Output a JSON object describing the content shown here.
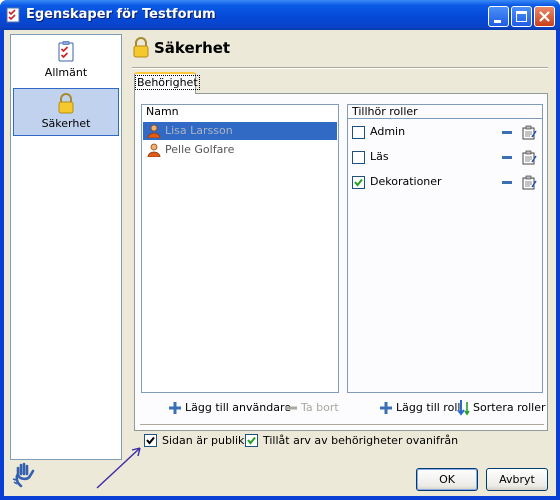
{
  "window": {
    "title": "Egenskaper för Testforum",
    "controls": [
      "minimize-icon",
      "maximize-icon",
      "close-icon"
    ]
  },
  "nav": {
    "items": [
      {
        "label": "Allmänt",
        "icon": "checklist-icon",
        "selected": false
      },
      {
        "label": "Säkerhet",
        "icon": "padlock-icon",
        "selected": true
      }
    ]
  },
  "header": {
    "title": "Säkerhet",
    "icon": "padlock-icon"
  },
  "tabs": [
    {
      "label": "Behörighet",
      "active": true
    }
  ],
  "users": {
    "column": "Namn",
    "rows": [
      {
        "name": "Lisa Larsson",
        "selected": true
      },
      {
        "name": "Pelle Golfare",
        "selected": false
      }
    ],
    "add_label": "Lägg till användare",
    "remove_label": "Ta bort"
  },
  "roles": {
    "column": "Tillhör roller",
    "rows": [
      {
        "name": "Admin",
        "checked": false
      },
      {
        "name": "Läs",
        "checked": false
      },
      {
        "name": "Dekorationer",
        "checked": true
      }
    ],
    "add_label": "Lägg till roll",
    "sort_label": "Sortera roller"
  },
  "options": {
    "public_label": "Sidan är publik",
    "public_checked": true,
    "inherit_label": "Tillåt arv av behörigheter ovanifrån",
    "inherit_checked": true
  },
  "buttons": {
    "ok": "OK",
    "cancel": "Avbryt"
  },
  "colors": {
    "titlebar": "#0a5ae6",
    "selection": "#316ac5",
    "face": "#ece9d8",
    "accent_tab": "#ffc83c"
  }
}
